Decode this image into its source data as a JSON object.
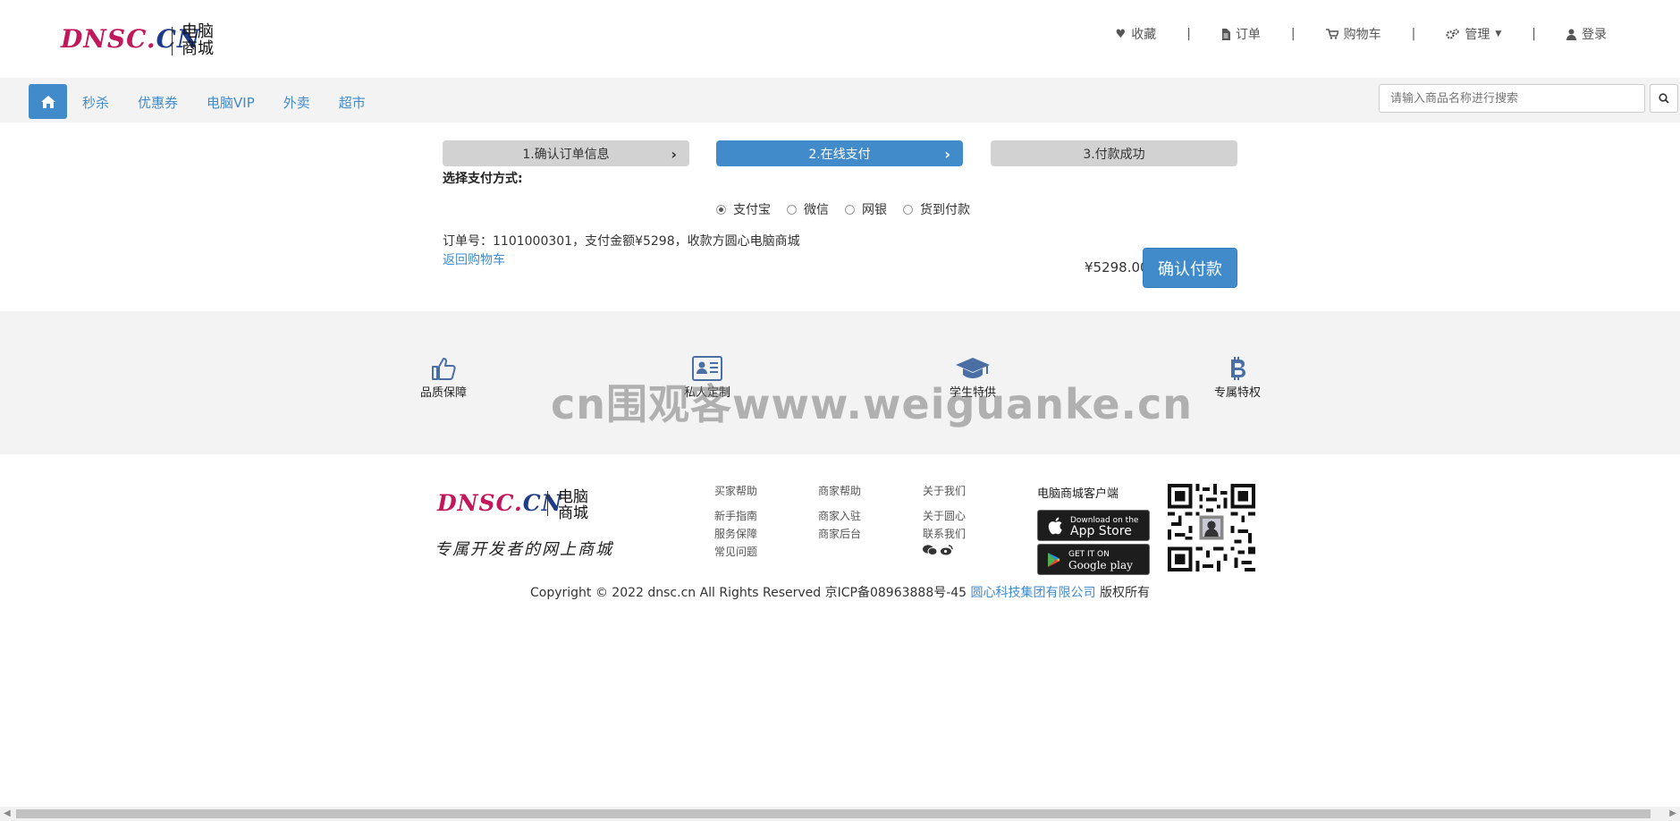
{
  "header": {
    "logo_part1": "DNSC.",
    "logo_part2": "CN",
    "logo_cn_line1": "电脑",
    "logo_cn_line2": "商城",
    "nav": {
      "favorites": "收藏",
      "orders": "订单",
      "cart": "购物车",
      "manage": "管理",
      "login": "登录",
      "separator": "|"
    }
  },
  "navbar": {
    "links": [
      "秒杀",
      "优惠券",
      "电脑VIP",
      "外卖",
      "超市"
    ],
    "search_placeholder": "请输入商品名称进行搜索"
  },
  "steps": [
    {
      "label": "1.确认订单信息",
      "active": false
    },
    {
      "label": "2.在线支付",
      "active": true
    },
    {
      "label": "3.付款成功",
      "active": false
    }
  ],
  "payment": {
    "choose_label": "选择支付方式:",
    "options": [
      {
        "label": "支付宝",
        "selected": true
      },
      {
        "label": "微信",
        "selected": false
      },
      {
        "label": "网银",
        "selected": false
      },
      {
        "label": "货到付款",
        "selected": false
      }
    ],
    "order_info": "订单号：1101000301，支付金额¥5298，收款方圆心电脑商城",
    "back_link": "返回购物车",
    "amount": "¥5298.00",
    "confirm_label": "确认付款"
  },
  "features": [
    {
      "label": "品质保障",
      "icon": "thumbs-up-icon"
    },
    {
      "label": "私人定制",
      "icon": "id-card-icon"
    },
    {
      "label": "学生特供",
      "icon": "graduation-cap-icon"
    },
    {
      "label": "专属特权",
      "icon": "bitcoin-icon"
    }
  ],
  "watermark": "cn围观客www.weiguanke.cn",
  "footer": {
    "slogan": "专属开发者的网上商城",
    "columns": [
      {
        "head": "买家帮助",
        "links": [
          "新手指南",
          "服务保障",
          "常见问题"
        ]
      },
      {
        "head": "商家帮助",
        "links": [
          "商家入驻",
          "商家后台"
        ]
      },
      {
        "head": "关于我们",
        "links": [
          "关于圆心",
          "联系我们"
        ]
      }
    ],
    "client_title": "电脑商城客户端",
    "appstore_small": "Download on the",
    "appstore_big": "App Store",
    "googleplay_small": "GET IT ON",
    "googleplay_big": "Google play",
    "copyright_pre": "Copyright © 2022 dnsc.cn All Rights Reserved 京ICP备08963888号-45 ",
    "copyright_link": "圆心科技集团有限公司",
    "copyright_post": " 版权所有"
  },
  "colors": {
    "accent": "#428bca",
    "logo_magenta": "#c2185b",
    "logo_navy": "#1f3c88",
    "band_gray": "#f3f3f3"
  }
}
